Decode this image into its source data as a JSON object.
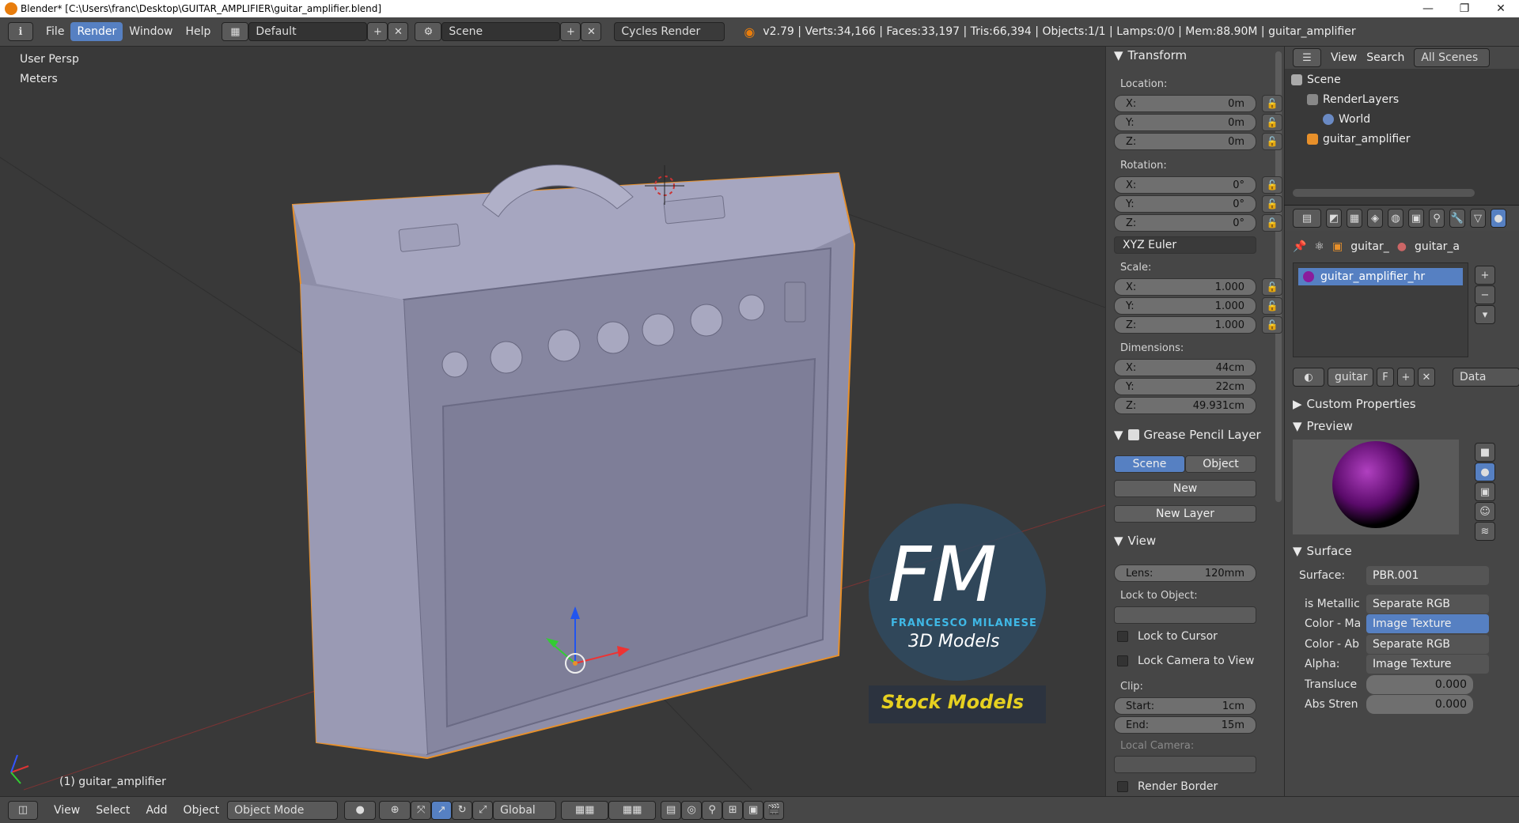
{
  "titlebar": {
    "title": "Blender* [C:\\Users\\franc\\Desktop\\GUITAR_AMPLIFIER\\guitar_amplifier.blend]",
    "minimize": "—",
    "maximize": "❐",
    "close": "✕"
  },
  "menu": {
    "file": "File",
    "render": "Render",
    "window": "Window",
    "help": "Help",
    "layout": "Default",
    "scene": "Scene",
    "engine": "Cycles Render",
    "stats": "v2.79 | Verts:34,166 | Faces:33,197 | Tris:66,394 | Objects:1/1 | Lamps:0/0 | Mem:88.90M | guitar_amplifier"
  },
  "viewport": {
    "view_name": "User Persp",
    "units": "Meters",
    "object_label": "(1) guitar_amplifier",
    "watermark": {
      "logo": "FM",
      "author": "FRANCESCO MILANESE",
      "subtitle": "3D Models",
      "banner": "Stock Models"
    }
  },
  "npanel": {
    "transform": "Transform",
    "location_label": "Location:",
    "loc": [
      {
        "axis": "X:",
        "value": "0m"
      },
      {
        "axis": "Y:",
        "value": "0m"
      },
      {
        "axis": "Z:",
        "value": "0m"
      }
    ],
    "rotation_label": "Rotation:",
    "rot": [
      {
        "axis": "X:",
        "value": "0°"
      },
      {
        "axis": "Y:",
        "value": "0°"
      },
      {
        "axis": "Z:",
        "value": "0°"
      }
    ],
    "rotation_mode": "XYZ Euler",
    "scale_label": "Scale:",
    "scale": [
      {
        "axis": "X:",
        "value": "1.000"
      },
      {
        "axis": "Y:",
        "value": "1.000"
      },
      {
        "axis": "Z:",
        "value": "1.000"
      }
    ],
    "dimensions_label": "Dimensions:",
    "dims": [
      {
        "axis": "X:",
        "value": "44cm"
      },
      {
        "axis": "Y:",
        "value": "22cm"
      },
      {
        "axis": "Z:",
        "value": "49.931cm"
      }
    ],
    "grease_pencil": "Grease Pencil Layer",
    "gp_scene": "Scene",
    "gp_object": "Object",
    "gp_new": "New",
    "gp_new_layer": "New Layer",
    "view": "View",
    "lens_label": "Lens:",
    "lens_value": "120mm",
    "lock_to_object": "Lock to Object:",
    "lock_to_cursor": "Lock to Cursor",
    "lock_camera": "Lock Camera to View",
    "clip_label": "Clip:",
    "clip_start_label": "Start:",
    "clip_start": "1cm",
    "clip_end_label": "End:",
    "clip_end": "15m",
    "local_camera": "Local Camera:",
    "render_border": "Render Border"
  },
  "outliner": {
    "view": "View",
    "search": "Search",
    "all_scenes": "All Scenes",
    "items": [
      "Scene",
      "RenderLayers",
      "World",
      "guitar_amplifier"
    ]
  },
  "properties": {
    "path1": "guitar_",
    "path2": "guitar_a",
    "material": "guitar_amplifier_hr",
    "mat_name": "guitar",
    "mat_f": "F",
    "data_link": "Data",
    "custom_props": "Custom Properties",
    "preview": "Preview",
    "surface_section": "Surface",
    "surface_label": "Surface:",
    "surface_value": "PBR.001",
    "rows": [
      {
        "label": "is Metallic",
        "value": "Separate RGB"
      },
      {
        "label": "Color - Ma",
        "value": "Image Texture"
      },
      {
        "label": "Color - Ab",
        "value": "Separate RGB"
      },
      {
        "label": "Alpha:",
        "value": "Image Texture"
      }
    ],
    "translucency_label": "Transluce",
    "translucency": "0.000",
    "abs_label": "Abs Stren",
    "abs": "0.000"
  },
  "bottombar": {
    "view": "View",
    "select": "Select",
    "add": "Add",
    "object": "Object",
    "mode": "Object Mode",
    "orientation": "Global"
  },
  "colors": {
    "accent": "#5680c2",
    "object_outline": "#e8902a",
    "amp_body": "#9c9cb8",
    "material_purple": "#8a1c9c"
  }
}
